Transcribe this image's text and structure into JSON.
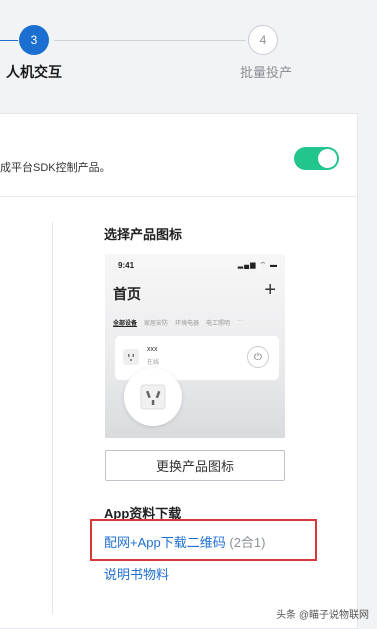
{
  "stepper": {
    "current_step_number": "3",
    "current_step_label": "人机交互",
    "next_step_number": "4",
    "next_step_label": "批量投产"
  },
  "card": {
    "description": "成平台SDK控制产品。",
    "toggle_on": true
  },
  "icon_section": {
    "title": "选择产品图标",
    "preview": {
      "time": "9:41",
      "status_icons": "▂▄▆ ⌔ ▬",
      "home_title": "首页",
      "plus": "+",
      "tabs": [
        "全部设备",
        "家居安防",
        "环境电器",
        "电工照明",
        "···"
      ],
      "device_name": "xxx",
      "device_status": "在线"
    },
    "change_button": "更换产品图标"
  },
  "download_section": {
    "title": "App资料下载",
    "qr_link": "配网+App下载二维码",
    "qr_note": "(2合1)",
    "manual_link": "说明书物料"
  },
  "colors": {
    "accent": "#1f6fd1",
    "toggle": "#22c58c",
    "highlight": "#d9383a"
  },
  "watermark": "头条 @瞄子说物联网"
}
